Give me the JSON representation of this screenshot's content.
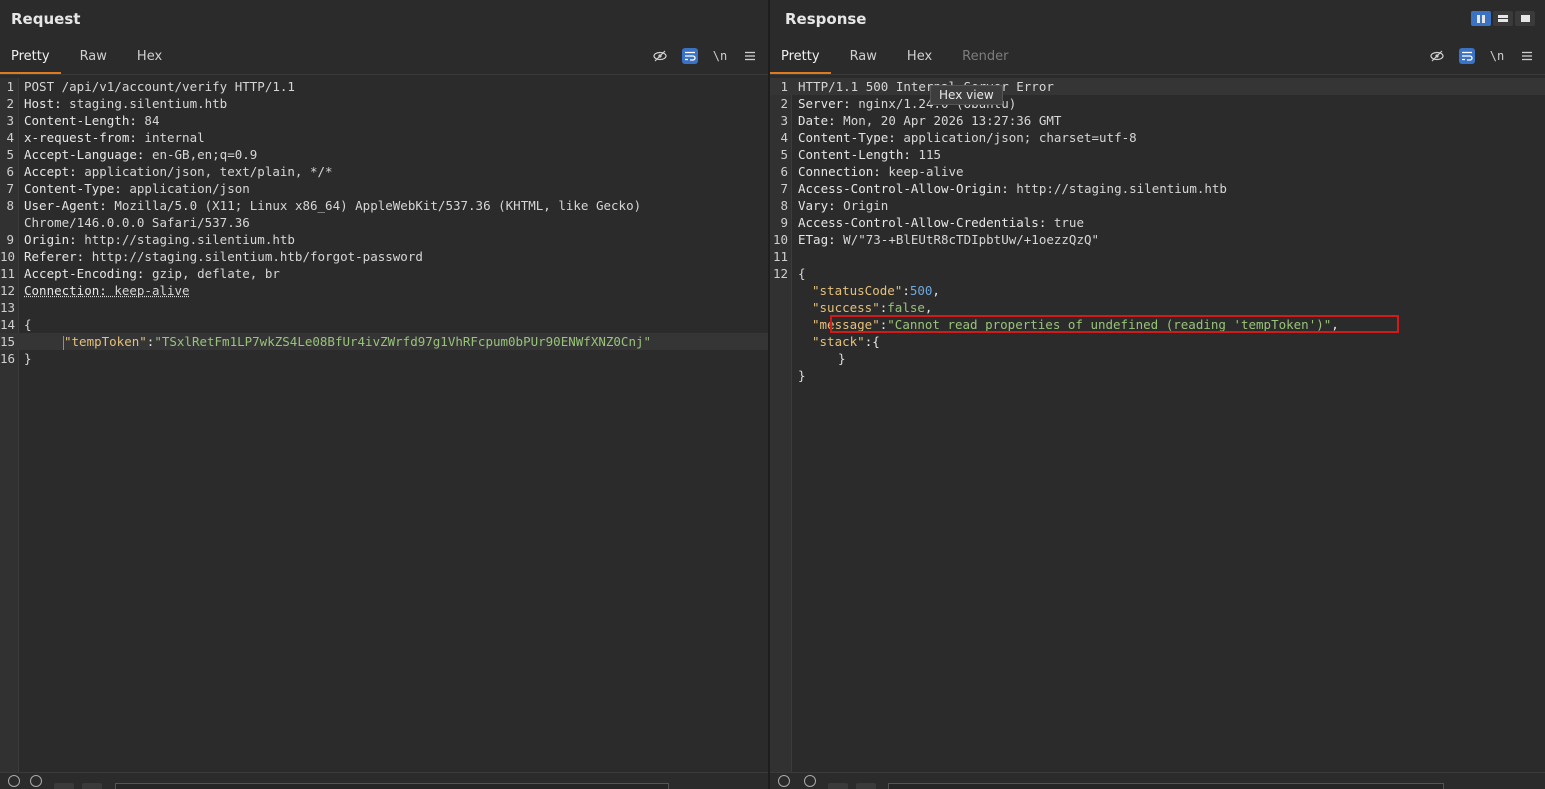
{
  "request": {
    "title": "Request",
    "tabs": [
      "Pretty",
      "Raw",
      "Hex"
    ],
    "active_tab": "Pretty",
    "toolbar": {
      "newline_label": "\\n"
    },
    "lines": [
      {
        "n": "1",
        "k": "",
        "v": "POST /api/v1/account/verify HTTP/1.1"
      },
      {
        "n": "2",
        "k": "Host:",
        "v": " staging.silentium.htb"
      },
      {
        "n": "3",
        "k": "Content-Length:",
        "v": " 84"
      },
      {
        "n": "4",
        "k": "x-request-from:",
        "v": " internal"
      },
      {
        "n": "5",
        "k": "Accept-Language:",
        "v": " en-GB,en;q=0.9"
      },
      {
        "n": "6",
        "k": "Accept:",
        "v": " application/json, text/plain, */*"
      },
      {
        "n": "7",
        "k": "Content-Type:",
        "v": " application/json"
      },
      {
        "n": "8",
        "k": "User-Agent:",
        "v": " Mozilla/5.0 (X11; Linux x86_64) AppleWebKit/537.36 (KHTML, like Gecko)"
      },
      {
        "n": "",
        "k": "",
        "v": "Chrome/146.0.0.0 Safari/537.36"
      },
      {
        "n": "9",
        "k": "Origin:",
        "v": " http://staging.silentium.htb"
      },
      {
        "n": "10",
        "k": "Referer:",
        "v": " http://staging.silentium.htb/forgot-password"
      },
      {
        "n": "11",
        "k": "Accept-Encoding:",
        "v": " gzip, deflate, br"
      },
      {
        "n": "12",
        "k": "Connection:",
        "v": " keep-alive"
      },
      {
        "n": "13",
        "k": "",
        "v": ""
      },
      {
        "n": "14",
        "k": "",
        "v": "{"
      },
      {
        "n": "15",
        "k": "",
        "v": ""
      },
      {
        "n": "16",
        "k": "",
        "v": "}"
      }
    ],
    "body_key": "\"tempToken\"",
    "body_value": "\"TSxlRetFm1LP7wkZS4Le08BfUr4ivZWrfd97g1VhRFcpum0bPUr90ENWfXNZ0Cnj\""
  },
  "response": {
    "title": "Response",
    "tabs": [
      "Pretty",
      "Raw",
      "Hex",
      "Render"
    ],
    "active_tab": "Pretty",
    "toolbar": {
      "newline_label": "\\n"
    },
    "tooltip": "Hex view",
    "lines": [
      {
        "n": "1",
        "k": "",
        "v": "HTTP/1.1 500 Internal Server Error"
      },
      {
        "n": "2",
        "k": "Server:",
        "v": " nginx/1.24.0 (Ubuntu)"
      },
      {
        "n": "3",
        "k": "Date:",
        "v": " Mon, 20 Apr 2026 13:27:36 GMT"
      },
      {
        "n": "4",
        "k": "Content-Type:",
        "v": " application/json; charset=utf-8"
      },
      {
        "n": "5",
        "k": "Content-Length:",
        "v": " 115"
      },
      {
        "n": "6",
        "k": "Connection:",
        "v": " keep-alive"
      },
      {
        "n": "7",
        "k": "Access-Control-Allow-Origin:",
        "v": " http://staging.silentium.htb"
      },
      {
        "n": "8",
        "k": "Vary:",
        "v": " Origin"
      },
      {
        "n": "9",
        "k": "Access-Control-Allow-Credentials:",
        "v": " true"
      },
      {
        "n": "10",
        "k": "ETag:",
        "v": " W/\"73-+BlEUtR8cTDIpbtUw/+1oezzQzQ\""
      },
      {
        "n": "11",
        "k": "",
        "v": ""
      },
      {
        "n": "12",
        "k": "",
        "v": "{"
      }
    ],
    "json": {
      "status_key": "\"statusCode\"",
      "status_val": "500",
      "success_key": "\"success\"",
      "success_val": "false",
      "message_key": "\"message\"",
      "message_val": "\"Cannot read properties of undefined (reading 'tempToken')\"",
      "stack_key": "\"stack\"",
      "stack_open": "{",
      "stack_close": "}",
      "close": "}"
    }
  }
}
